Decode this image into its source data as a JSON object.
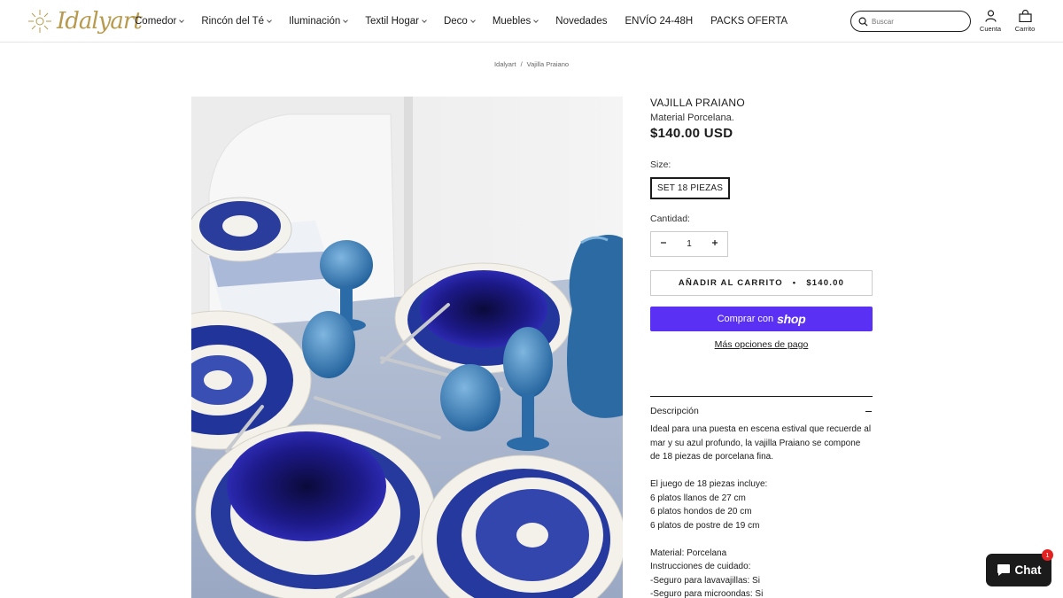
{
  "brand": {
    "logo_text": "Idalyart",
    "accent_color": "#b89a4e"
  },
  "nav": {
    "items": [
      {
        "label": "Comedor",
        "has_dropdown": true
      },
      {
        "label": "Rincón del Té",
        "has_dropdown": true
      },
      {
        "label": "Iluminación",
        "has_dropdown": true
      },
      {
        "label": "Textil Hogar",
        "has_dropdown": true
      },
      {
        "label": "Deco",
        "has_dropdown": true
      },
      {
        "label": "Muebles",
        "has_dropdown": true
      },
      {
        "label": "Novedades",
        "has_dropdown": false
      },
      {
        "label": "ENVÍO 24-48H",
        "has_dropdown": false
      },
      {
        "label": "PACKS OFERTA",
        "has_dropdown": false
      }
    ]
  },
  "search": {
    "placeholder": "Buscar"
  },
  "header_icons": {
    "account_label": "Cuenta",
    "cart_label": "Carrito"
  },
  "breadcrumb": {
    "home": "Idalyart",
    "current": "Vajilla Praiano"
  },
  "product": {
    "title": "VAJILLA PRAIANO",
    "subtitle": "Material Porcelana.",
    "price": "$140.00 USD",
    "size_label": "Size:",
    "size_option": "SET 18 PIEZAS",
    "quantity_label": "Cantidad:",
    "quantity": "1",
    "add_to_cart": "AÑADIR AL CARRITO",
    "add_to_cart_separator": "•",
    "add_to_cart_price": "$140.00",
    "shop_pay_prefix": "Comprar con",
    "shop_pay_brand": "shop",
    "shop_pay_color": "#5a31f4",
    "more_payment": "Más opciones de pago",
    "description_heading": "Descripción",
    "description": [
      "Ideal para una puesta en escena estival que recuerde al mar y su azul profundo, la vajilla Praiano se compone de 18 piezas de porcelana fina.",
      "El juego de 18 piezas incluye:\n6 platos llanos de 27 cm\n6 platos hondos de 20 cm\n6 platos de postre de 19 cm",
      "Material: Porcelana\nInstrucciones de cuidado:\n-Seguro para lavavajillas: Si\n-Seguro para microondas: Si"
    ]
  },
  "chat": {
    "label": "Chat",
    "badge": "1"
  }
}
